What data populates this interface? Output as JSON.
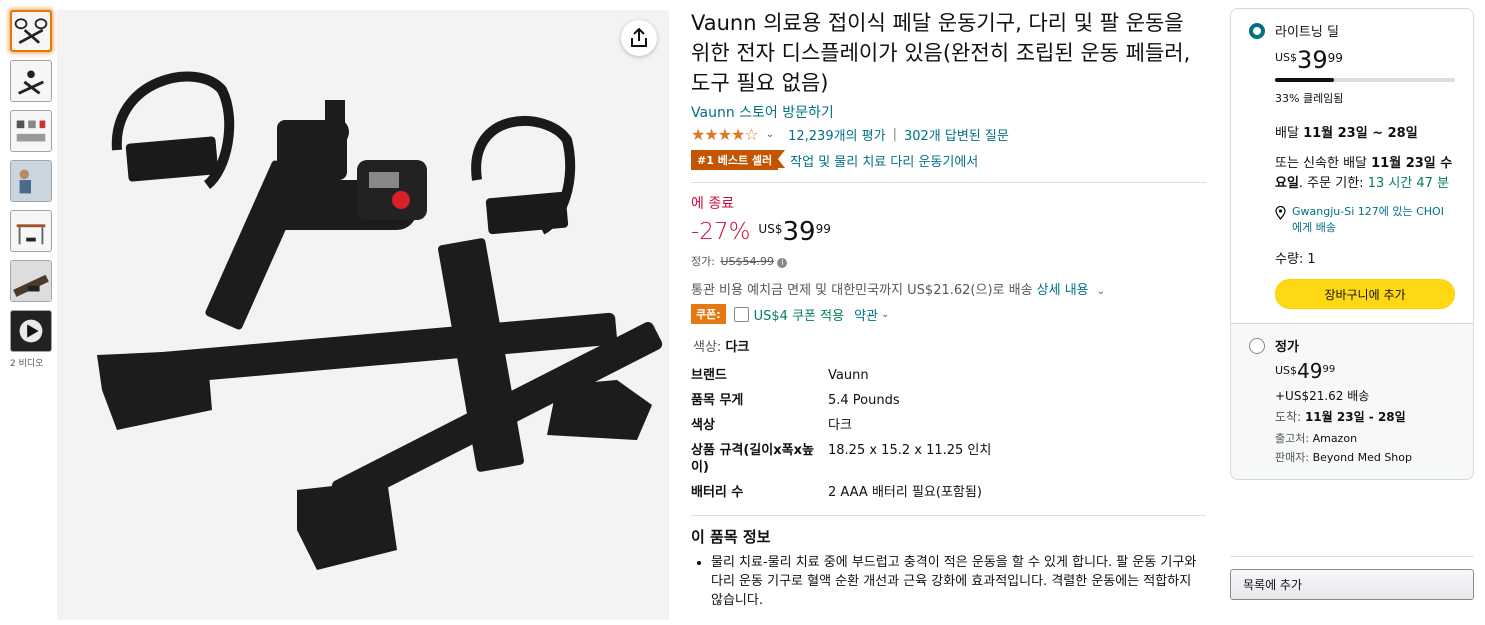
{
  "video_count_label": "2 비디오",
  "product": {
    "title": "Vaunn 의료용 접이식 페달 운동기구, 다리 및 팔 운동을 위한 전자 디스플레이가 있음(완전히 조립된 운동 페들러, 도구 필요 없음)",
    "store_link": "Vaunn 스토어 방문하기",
    "stars": "★★★★☆",
    "rating_count": "12,239개의 평가",
    "answered_questions": "302개 답변된 질문",
    "best_seller_badge": "#1 베스트 셀러",
    "best_seller_category": "작업 및 물리 치료 다리 운동기에서"
  },
  "pricing": {
    "deal_ends": "에 종료",
    "discount": "-27%",
    "currency": "US$",
    "whole": "39",
    "fraction": "99",
    "list_price_label": "정가:",
    "list_price": "US$54.99",
    "shipping_text": "통관 비용 예치금 면제 및 대한민국까지 US$21.62(으)로 배송",
    "shipping_details_link": "상세 내용",
    "coupon_badge": "쿠폰:",
    "coupon_text": "US$4 쿠폰 적용",
    "coupon_terms": "약관"
  },
  "color": {
    "label": "색상:",
    "value": "다크"
  },
  "specs": [
    {
      "key": "브랜드",
      "value": "Vaunn"
    },
    {
      "key": "품목 무게",
      "value": "5.4 Pounds"
    },
    {
      "key": "색상",
      "value": "다크"
    },
    {
      "key": "상품 규격(길이x폭x높이)",
      "value": "18.25 x 15.2 x 11.25 인치"
    },
    {
      "key": "배터리 수",
      "value": "2 AAA 배터리 필요(포함됨)"
    }
  ],
  "about": {
    "title": "이 품목 정보",
    "bullets": [
      "물리 치료-물리 치료 중에 부드럽고 충격이 적은 운동을 할 수 있게 합니다. 팔 운동 기구와 다리 운동 기구로 혈액 순환 개선과 근육 강화에 효과적입니다. 격렬한 운동에는 적합하지 않습니다."
    ]
  },
  "buybox": {
    "deal": {
      "label": "라이트닝 딜",
      "currency": "US$",
      "whole": "39",
      "fraction": "99",
      "claimed_fraction": 0.33,
      "claimed": "33% 클레임됨",
      "delivery_prefix": "배달",
      "delivery_dates": "11월 23일 ~ 28일",
      "fast_prefix": "또는 신속한 배달",
      "fast_date": "11월 23일 수요일",
      "order_within": ". 주문 기한:",
      "time_left": "13 시간 47 분",
      "location": "Gwangju-Si 127에 있는 CHOI 에게 배송",
      "quantity": "수량: 1",
      "add_to_cart": "장바구니에 추가"
    },
    "regular": {
      "label": "정가",
      "currency": "US$",
      "whole": "49",
      "fraction": "99",
      "shipping": "+US$21.62 배송",
      "arrive_label": "도착:",
      "arrive_dates": "11월 23일 - 28일",
      "ships_from_label": "출고처:",
      "ships_from": "Amazon",
      "seller_label": "판매자:",
      "seller": "Beyond Med Shop"
    }
  },
  "wishlist_button": "목록에 추가",
  "colors": {
    "link": "#007185",
    "deal_red": "#cc0c39",
    "cart_yellow": "#ffd814",
    "badge_orange": "#c45500"
  }
}
